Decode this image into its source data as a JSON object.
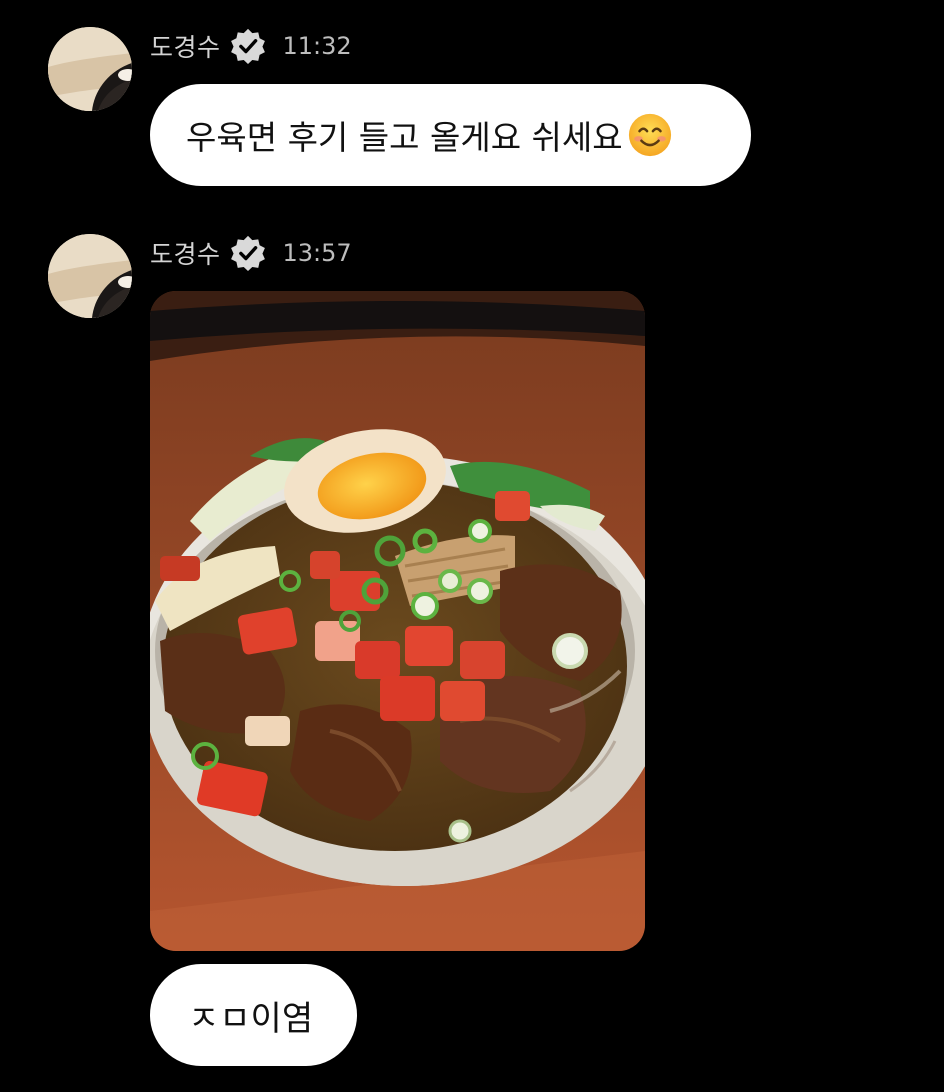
{
  "messages": [
    {
      "sender": "도경수",
      "time": "11:32",
      "verified_icon": "verified-badge-icon",
      "text": "우육면 후기 들고 올게요 쉬세요",
      "emoji": "smiling-face-icon"
    },
    {
      "sender": "도경수",
      "time": "13:57",
      "verified_icon": "verified-badge-icon",
      "photo": "beef-noodle-soup-photo",
      "reply_text": "ㅈㅁ이염"
    }
  ],
  "colors": {
    "background": "#000000",
    "bubble": "#ffffff",
    "bubble_text": "#111111",
    "name_text": "#d4d4d4",
    "time_text": "#bdbdbd",
    "badge": "#d9d9d9"
  }
}
